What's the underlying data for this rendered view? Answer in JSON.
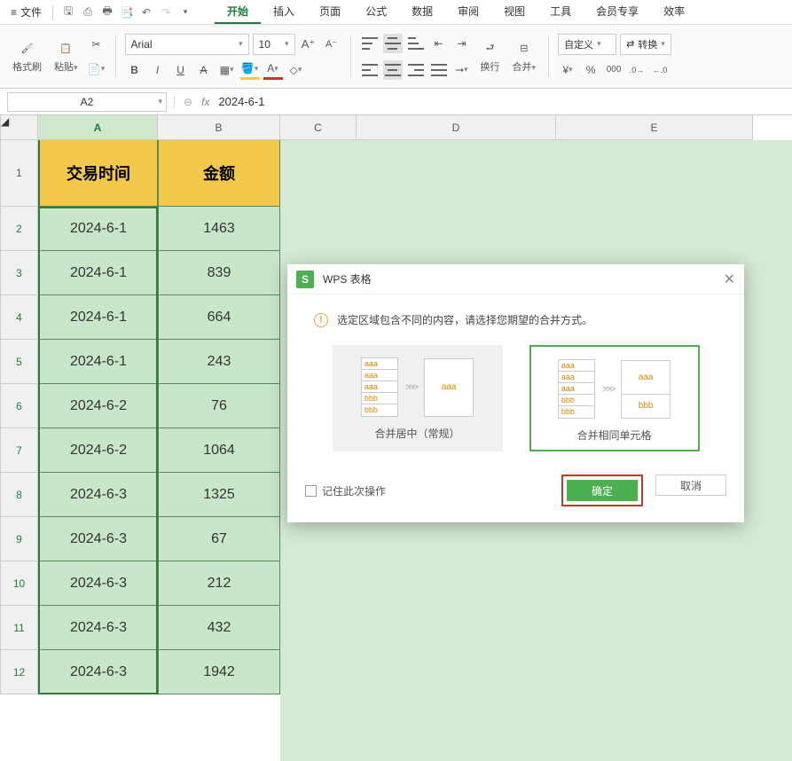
{
  "menubar": {
    "file": "文件",
    "tabs": [
      "开始",
      "插入",
      "页面",
      "公式",
      "数据",
      "审阅",
      "视图",
      "工具",
      "会员专享",
      "效率"
    ],
    "active_index": 0
  },
  "ribbon": {
    "format_painter": "格式刷",
    "paste": "粘贴",
    "font_name": "Arial",
    "font_size": "10",
    "wrap": "换行",
    "merge": "合并",
    "number_format": "自定义",
    "convert": "转换"
  },
  "formula_bar": {
    "cell_ref": "A2",
    "value": "2024-6-1"
  },
  "columns": [
    "A",
    "B",
    "C",
    "D",
    "E"
  ],
  "rows": [
    "1",
    "2",
    "3",
    "4",
    "5",
    "6",
    "7",
    "8",
    "9",
    "10",
    "11",
    "12"
  ],
  "headers": {
    "col_a": "交易时间",
    "col_b": "金额"
  },
  "table": [
    {
      "date": "2024-6-1",
      "amount": "1463"
    },
    {
      "date": "2024-6-1",
      "amount": "839"
    },
    {
      "date": "2024-6-1",
      "amount": "664"
    },
    {
      "date": "2024-6-1",
      "amount": "243"
    },
    {
      "date": "2024-6-2",
      "amount": "76"
    },
    {
      "date": "2024-6-2",
      "amount": "1064"
    },
    {
      "date": "2024-6-3",
      "amount": "1325"
    },
    {
      "date": "2024-6-3",
      "amount": "67"
    },
    {
      "date": "2024-6-3",
      "amount": "212"
    },
    {
      "date": "2024-6-3",
      "amount": "432"
    },
    {
      "date": "2024-6-3",
      "amount": "1942"
    }
  ],
  "dialog": {
    "title": "WPS 表格",
    "message": "选定区域包含不同的内容，请选择您期望的合并方式。",
    "sample_a": "aaa",
    "sample_b": "bbb",
    "option1_label": "合并居中（常规）",
    "option2_label": "合并相同单元格",
    "remember": "记住此次操作",
    "ok": "确定",
    "cancel": "取消"
  }
}
